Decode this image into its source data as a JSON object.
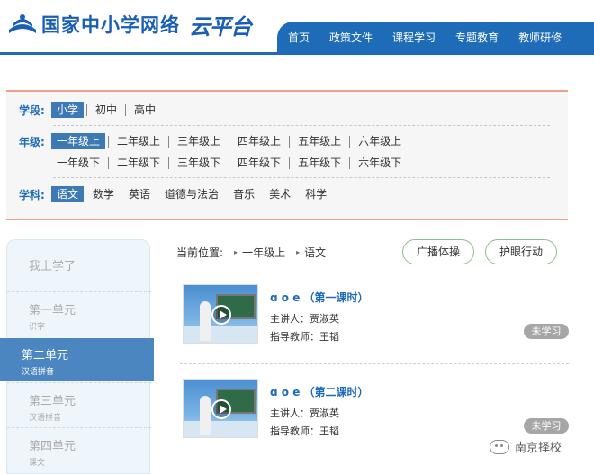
{
  "header": {
    "title": "国家中小学网络",
    "title_script": "云平台",
    "nav": [
      "首页",
      "政策文件",
      "课程学习",
      "专题教育",
      "教师研修"
    ]
  },
  "filter": {
    "stage": {
      "label": "学段:",
      "options": [
        "小学",
        "初中",
        "高中"
      ],
      "selected": "小学"
    },
    "grade": {
      "label": "年级:",
      "row1": [
        "一年级上",
        "二年级上",
        "三年级上",
        "四年级上",
        "五年级上",
        "六年级上"
      ],
      "row2": [
        "一年级下",
        "二年级下",
        "三年级下",
        "四年级下",
        "五年级下",
        "六年级下"
      ],
      "selected": "一年级上"
    },
    "subject": {
      "label": "学科:",
      "options": [
        "语文",
        "数学",
        "英语",
        "道德与法治",
        "音乐",
        "美术",
        "科学"
      ],
      "selected": "语文"
    }
  },
  "sidebar": {
    "header": "我上学了",
    "items": [
      {
        "title": "第一单元",
        "sub": "识字"
      },
      {
        "title": "第二单元",
        "sub": "汉语拼音"
      },
      {
        "title": "第三单元",
        "sub": "汉语拼音"
      },
      {
        "title": "第四单元",
        "sub": "课文"
      }
    ],
    "active_index": 1
  },
  "breadcrumb": {
    "label": "当前位置:",
    "path": [
      "一年级上",
      "语文"
    ]
  },
  "actions": {
    "broadcast": "广播体操",
    "eyecare": "护眼行动"
  },
  "lessons": [
    {
      "title": "ɑ o e （第一课时）",
      "speaker": "主讲人：贾淑英",
      "teacher": "指导教师：王韬",
      "status": "未学习"
    },
    {
      "title": "ɑ o e （第二课时）",
      "speaker": "主讲人：贾淑英",
      "teacher": "指导教师：王韬",
      "status": "未学习"
    }
  ],
  "watermark": "南京择校",
  "colors": {
    "brand": "#1e6bb8",
    "accent": "#f0a08a",
    "active": "#3d79b5"
  }
}
